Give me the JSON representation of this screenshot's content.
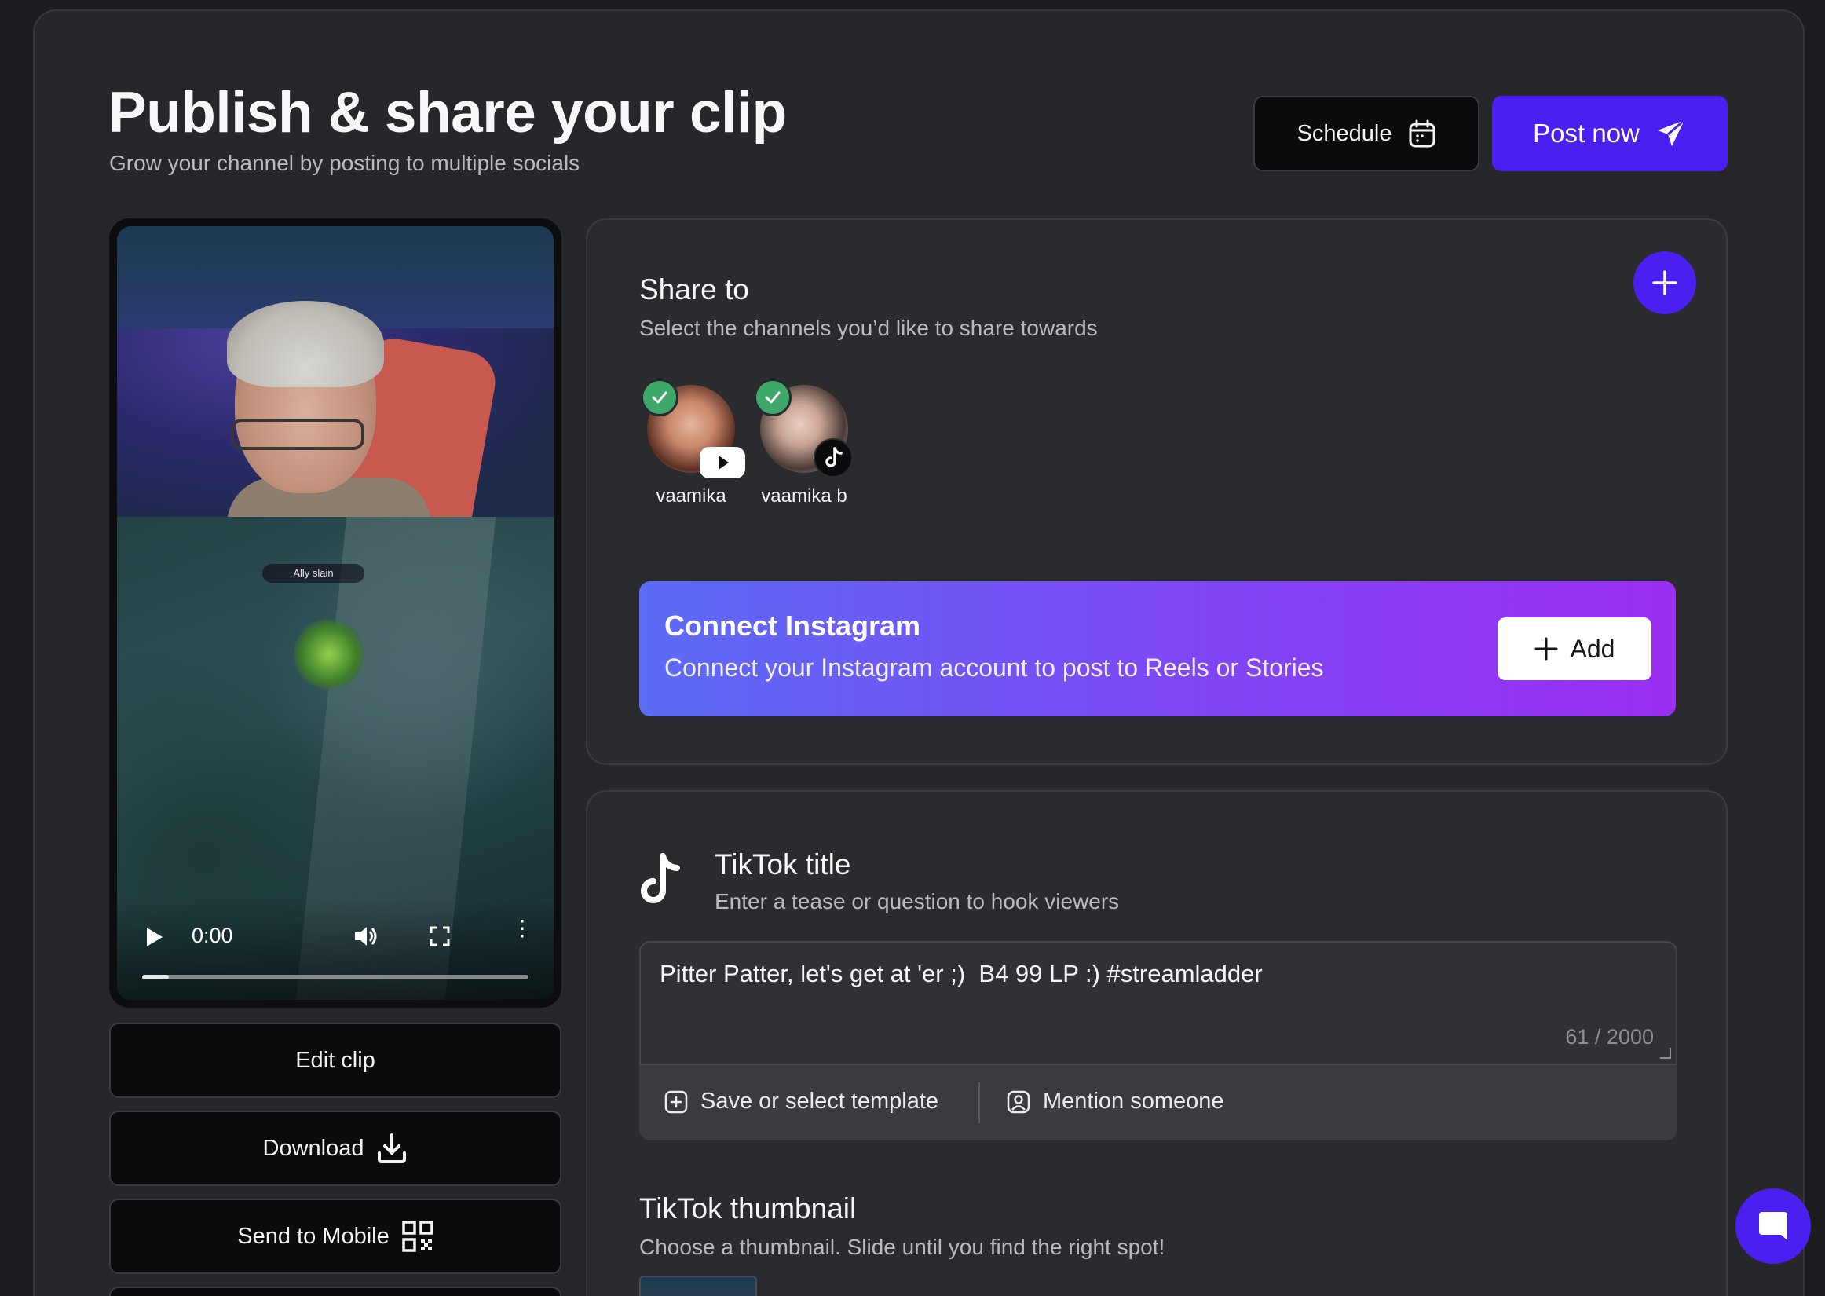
{
  "header": {
    "title": "Publish & share your clip",
    "subtitle": "Grow your channel by posting to multiple socials",
    "schedule_label": "Schedule",
    "post_label": "Post now"
  },
  "video": {
    "time": "0:00",
    "progress": 0.07,
    "killfeed": "Ally slain"
  },
  "side_actions": {
    "edit_label": "Edit clip",
    "download_label": "Download",
    "mobile_label": "Send to Mobile"
  },
  "share": {
    "title": "Share to",
    "subtitle": "Select the channels you’d like to share towards",
    "channels": [
      {
        "name": "vaamika",
        "platform": "youtube",
        "selected": true
      },
      {
        "name": "vaamika b",
        "platform": "tiktok",
        "selected": true
      }
    ],
    "instagram": {
      "title": "Connect Instagram",
      "subtitle": "Connect your Instagram account to post to Reels or Stories",
      "add_label": "Add"
    }
  },
  "tiktok": {
    "title": "TikTok title",
    "subtitle": "Enter a tease or question to hook viewers",
    "value": "Pitter Patter, let's get at 'er ;)  B4 99 LP :) #streamladder",
    "count": "61 / 2000",
    "template_label": "Save or select template",
    "mention_label": "Mention someone",
    "thumb_title": "TikTok thumbnail",
    "thumb_subtitle": "Choose a thumbnail. Slide until you find the right spot!"
  },
  "colors": {
    "accent": "#4b1ff0",
    "check": "#3ea86a",
    "instagram_gradient_start": "#5b6cf5",
    "instagram_gradient_end": "#9b2ef2"
  }
}
